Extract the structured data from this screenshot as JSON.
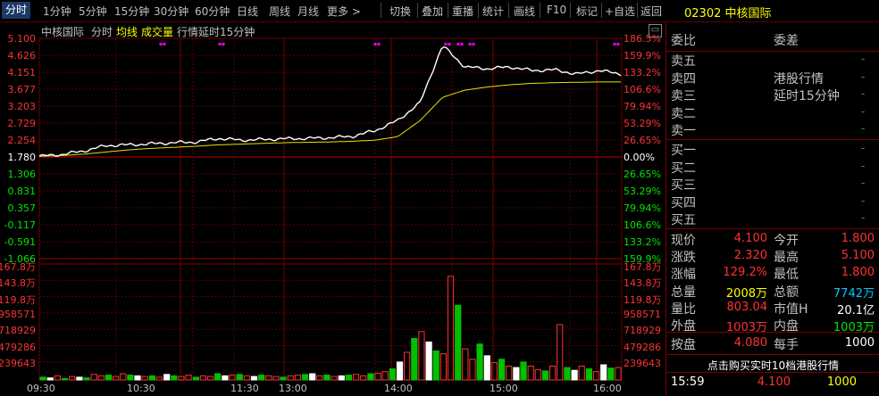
{
  "toolbar": {
    "periods": [
      "分时",
      "1分钟",
      "5分钟",
      "15分钟",
      "30分钟",
      "60分钟",
      "日线",
      "周线",
      "月线",
      "更多 >"
    ],
    "actions": [
      "切换",
      "叠加",
      "重播",
      "统计",
      "画线",
      "F10",
      "标记",
      "+自选",
      "返回"
    ]
  },
  "stock": {
    "code": "02302",
    "name": "中核国际"
  },
  "chart_header": {
    "name": "中核国际",
    "mode": "分时",
    "avg_label": "均线",
    "vol_label": "成交量",
    "delay_note": "行情延时15分钟"
  },
  "price_axis": {
    "left": [
      "5.100",
      "4.626",
      "4.151",
      "3.677",
      "3.203",
      "2.729",
      "2.254",
      "1.780",
      "1.306",
      "0.831",
      "0.357",
      "-0.117",
      "-0.591",
      "-1.066"
    ],
    "right": [
      "186.5%",
      "159.9%",
      "133.2%",
      "106.6%",
      "79.94%",
      "53.29%",
      "26.65%",
      "0.00%",
      "26.65%",
      "53.29%",
      "79.94%",
      "106.6%",
      "133.2%",
      "159.9%"
    ]
  },
  "volume_axis": {
    "left": [
      "167.8万",
      "143.8万",
      "119.8万",
      "958571",
      "718929",
      "479286",
      "239643"
    ],
    "right": [
      "167.8万",
      "143.8万",
      "119.8万",
      "958571",
      "718929",
      "479286",
      "239643"
    ]
  },
  "time_axis": [
    "09:30",
    "10:30",
    "11:30",
    "13:00",
    "14:00",
    "15:00",
    "16:00"
  ],
  "chart_data": {
    "type": "line",
    "title": "",
    "xlabel": "",
    "ylabel": "",
    "prev_close": 1.78,
    "ylim": [
      -1.066,
      5.1
    ],
    "x": [
      "09:30",
      "09:45",
      "10:00",
      "10:15",
      "10:30",
      "10:45",
      "11:00",
      "11:15",
      "11:30",
      "13:00",
      "13:15",
      "13:30",
      "13:45",
      "14:00",
      "14:15",
      "14:30",
      "14:40",
      "14:45",
      "14:50",
      "14:55",
      "15:00",
      "15:10",
      "15:20",
      "15:30",
      "15:40",
      "15:50",
      "16:00"
    ],
    "series": [
      {
        "values": [
          1.8,
          1.85,
          1.95,
          2.1,
          2.12,
          2.15,
          2.18,
          2.2,
          2.3,
          2.25,
          2.27,
          2.29,
          2.3,
          2.32,
          2.36,
          2.52,
          2.8,
          3.3,
          4.9,
          4.3,
          4.25,
          4.3,
          4.2,
          4.22,
          4.1,
          4.2,
          4.1
        ]
      },
      {
        "values": [
          1.8,
          1.82,
          1.86,
          1.92,
          1.98,
          2.02,
          2.05,
          2.08,
          2.12,
          2.14,
          2.16,
          2.18,
          2.19,
          2.2,
          2.22,
          2.25,
          2.35,
          2.8,
          3.45,
          3.65,
          3.74,
          3.8,
          3.84,
          3.86,
          3.87,
          3.88,
          3.88
        ]
      }
    ],
    "volume": {
      "ylim": [
        0,
        1678000
      ],
      "values": [
        40000,
        30000,
        60000,
        20000,
        50000,
        40000,
        30000,
        80000,
        60000,
        70000,
        50000,
        90000,
        70000,
        60000,
        50000,
        60000,
        40000,
        80000,
        60000,
        50000,
        70000,
        40000,
        60000,
        50000,
        90000,
        60000,
        70000,
        80000,
        60000,
        50000,
        70000,
        60000,
        50000,
        40000,
        60000,
        70000,
        80000,
        90000,
        60000,
        70000,
        50000,
        60000,
        70000,
        80000,
        60000,
        90000,
        100000,
        120000,
        160000,
        260000,
        400000,
        600000,
        700000,
        550000,
        420000,
        380000,
        1500000,
        1080000,
        450000,
        300000,
        520000,
        350000,
        250000,
        300000,
        200000,
        180000,
        260000,
        200000,
        150000,
        130000,
        200000,
        800000,
        180000,
        140000,
        200000,
        160000,
        120000,
        220000,
        170000,
        180000
      ]
    },
    "markers": [
      180,
      246,
      420,
      499,
      513,
      526,
      688
    ]
  },
  "panel": {
    "header": {
      "left": "委比",
      "right": "委差"
    },
    "sell_labels": [
      "卖五",
      "卖四",
      "卖三",
      "卖二",
      "卖一"
    ],
    "buy_labels": [
      "买一",
      "买二",
      "买三",
      "买四",
      "买五"
    ],
    "placeholder": "-",
    "notice_line1": "港股行情",
    "notice_line2": "延时15分钟",
    "quote": [
      {
        "l1": "现价",
        "v1": "4.100",
        "c1": "red",
        "l2": "今开",
        "v2": "1.800",
        "c2": "red"
      },
      {
        "l1": "涨跌",
        "v1": "2.320",
        "c1": "red",
        "l2": "最高",
        "v2": "5.100",
        "c2": "red"
      },
      {
        "l1": "涨幅",
        "v1": "129.2%",
        "c1": "red",
        "l2": "最低",
        "v2": "1.800",
        "c2": "red"
      },
      {
        "l1": "总量",
        "v1": "2008万",
        "c1": "yellow",
        "l2": "总额",
        "v2": "7742万",
        "c2": "cyan"
      },
      {
        "l1": "量比",
        "v1": "803.04",
        "c1": "red",
        "l2": "市值H",
        "v2": "20.1亿",
        "c2": "white"
      },
      {
        "l1": "外盘",
        "v1": "1003万",
        "c1": "red",
        "l2": "内盘",
        "v2": "1003万",
        "c2": "green"
      }
    ],
    "close_quote": {
      "l1": "按盘",
      "v1": "4.080",
      "l2": "每手",
      "v2": "1000"
    },
    "promo": "点击购买实时10档港股行情",
    "ticks": [
      {
        "time": "15:59",
        "price": "4.100",
        "vol": "1000"
      }
    ]
  }
}
